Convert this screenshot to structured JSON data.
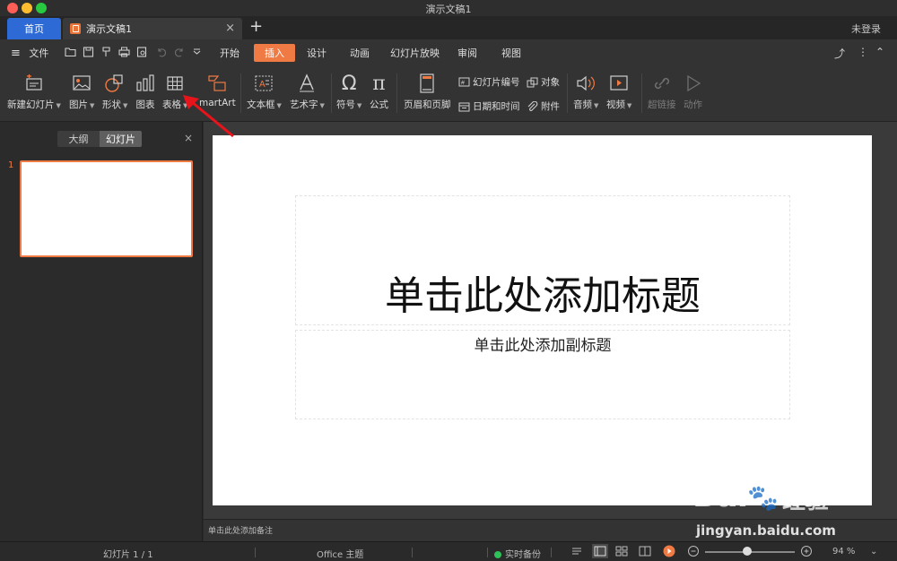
{
  "window": {
    "title": "演示文稿1"
  },
  "tabs": {
    "home": "首页",
    "doc": "演示文稿1",
    "close": "×",
    "add": "+",
    "login": "未登录"
  },
  "menu": {
    "hamburger_label": "文件",
    "tabs": [
      "开始",
      "插入",
      "设计",
      "动画",
      "幻灯片放映",
      "审阅",
      "视图"
    ],
    "active_tab": "插入"
  },
  "ribbon": {
    "new_slide": "新建幻灯片",
    "picture": "图片",
    "shape": "形状",
    "chart": "图表",
    "table": "表格",
    "smartart": "martArt",
    "textbox": "文本框",
    "wordart": "艺术字",
    "symbol": "符号",
    "formula": "公式",
    "header_footer": "页眉和页脚",
    "slide_number": "幻灯片编号",
    "object": "对象",
    "date_time": "日期和时间",
    "attachment": "附件",
    "audio": "音频",
    "video": "视频",
    "hyperlink": "超链接",
    "action": "动作"
  },
  "left_panel": {
    "outline": "大纲",
    "slides": "幻灯片",
    "close": "×",
    "slide_number": "1"
  },
  "slide": {
    "title_placeholder": "单击此处添加标题",
    "subtitle_placeholder": "单击此处添加副标题"
  },
  "notes": {
    "placeholder": "单击此处添加备注"
  },
  "status": {
    "slide_counter": "幻灯片 1 / 1",
    "theme": "Office 主题",
    "backup": "实时备份",
    "zoom": "94 %"
  },
  "watermark": {
    "brand": "Bai",
    "brand2": "du",
    "suffix": "经验",
    "url": "jingyan.baidu.com"
  },
  "colors": {
    "accent": "#f07a43",
    "home_tab": "#2d6ad6",
    "arrow": "#e8141b"
  }
}
